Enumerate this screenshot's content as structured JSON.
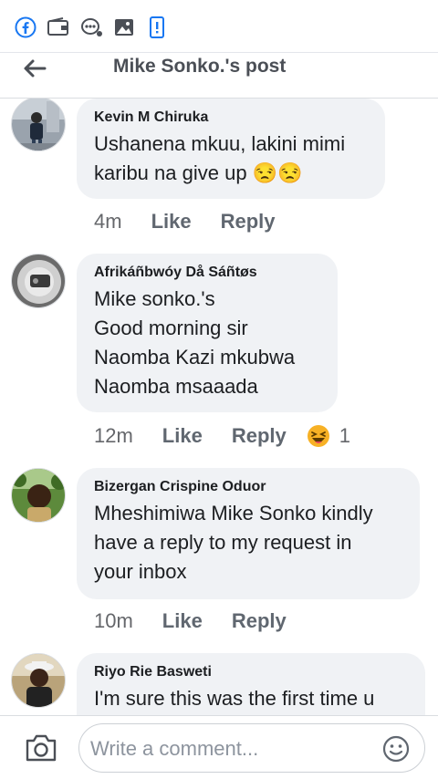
{
  "status_bar": {
    "icons": [
      "facebook-icon",
      "wallet-icon",
      "messenger-bubble-icon",
      "image-icon",
      "phone-alert-icon"
    ],
    "accent": "#1877f2"
  },
  "header": {
    "title": "Mike Sonko.'s post",
    "back_icon": "arrow-left-icon"
  },
  "comments": [
    {
      "author": "Kevin M Chiruka",
      "lines": [
        "Ushanena mkuu, lakini mimi",
        "karibu na give up 😒😒"
      ],
      "time": "4m",
      "like": "Like",
      "reply": "Reply"
    },
    {
      "author": "Afrikáñbwóy Då Sáñtøs",
      "lines": [
        "Mike sonko.'s",
        "Good morning sir",
        "Naomba Kazi mkubwa",
        "Naomba msaaada"
      ],
      "time": "12m",
      "like": "Like",
      "reply": "Reply",
      "reaction_icon": "haha-reaction-icon",
      "reaction_count": "1"
    },
    {
      "author": "Bizergan Crispine Oduor",
      "lines": [
        "Mheshimiwa Mike Sonko kindly",
        "have a reply to my request in",
        "your inbox"
      ],
      "time": "10m",
      "like": "Like",
      "reply": "Reply"
    },
    {
      "author": "Riyo Rie Basweti",
      "lines": [
        "I'm sure this was the first time u"
      ],
      "time": "",
      "like": "",
      "reply": ""
    }
  ],
  "footer": {
    "placeholder": "Write a comment...",
    "camera_icon": "camera-icon",
    "emoji_icon": "emoji-smile-icon"
  }
}
